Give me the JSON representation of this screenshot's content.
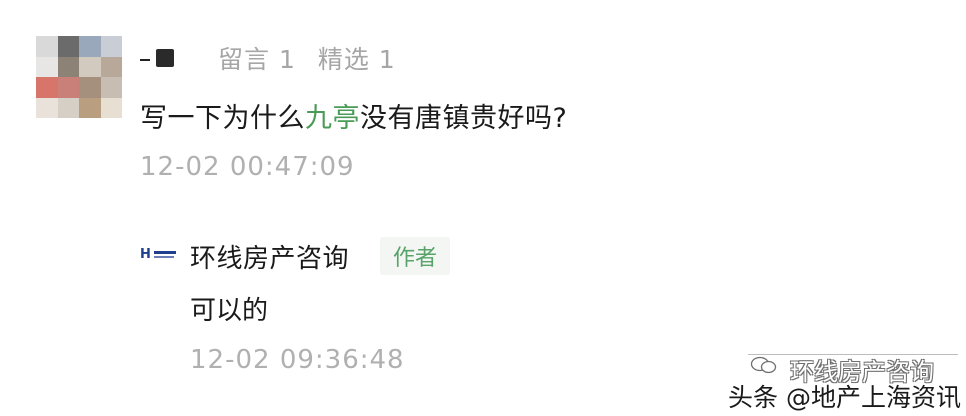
{
  "comment": {
    "stats_left": "留言 1",
    "stats_right": "精选 1",
    "text_before": "写一下为什么",
    "text_highlight": "九亭",
    "text_after": "没有唐镇贵好吗?",
    "timestamp": "12-02 00:47:09"
  },
  "reply": {
    "author": "环线房产咨询",
    "badge": "作者",
    "text": "可以的",
    "timestamp": "12-02 09:36:48"
  },
  "watermark": {
    "account": "环线房产咨询",
    "source": "头条 @地产上海资讯"
  },
  "colors": {
    "highlight": "#4a9b57",
    "meta_gray": "#a6a6a6",
    "badge_green": "#57a36a"
  }
}
